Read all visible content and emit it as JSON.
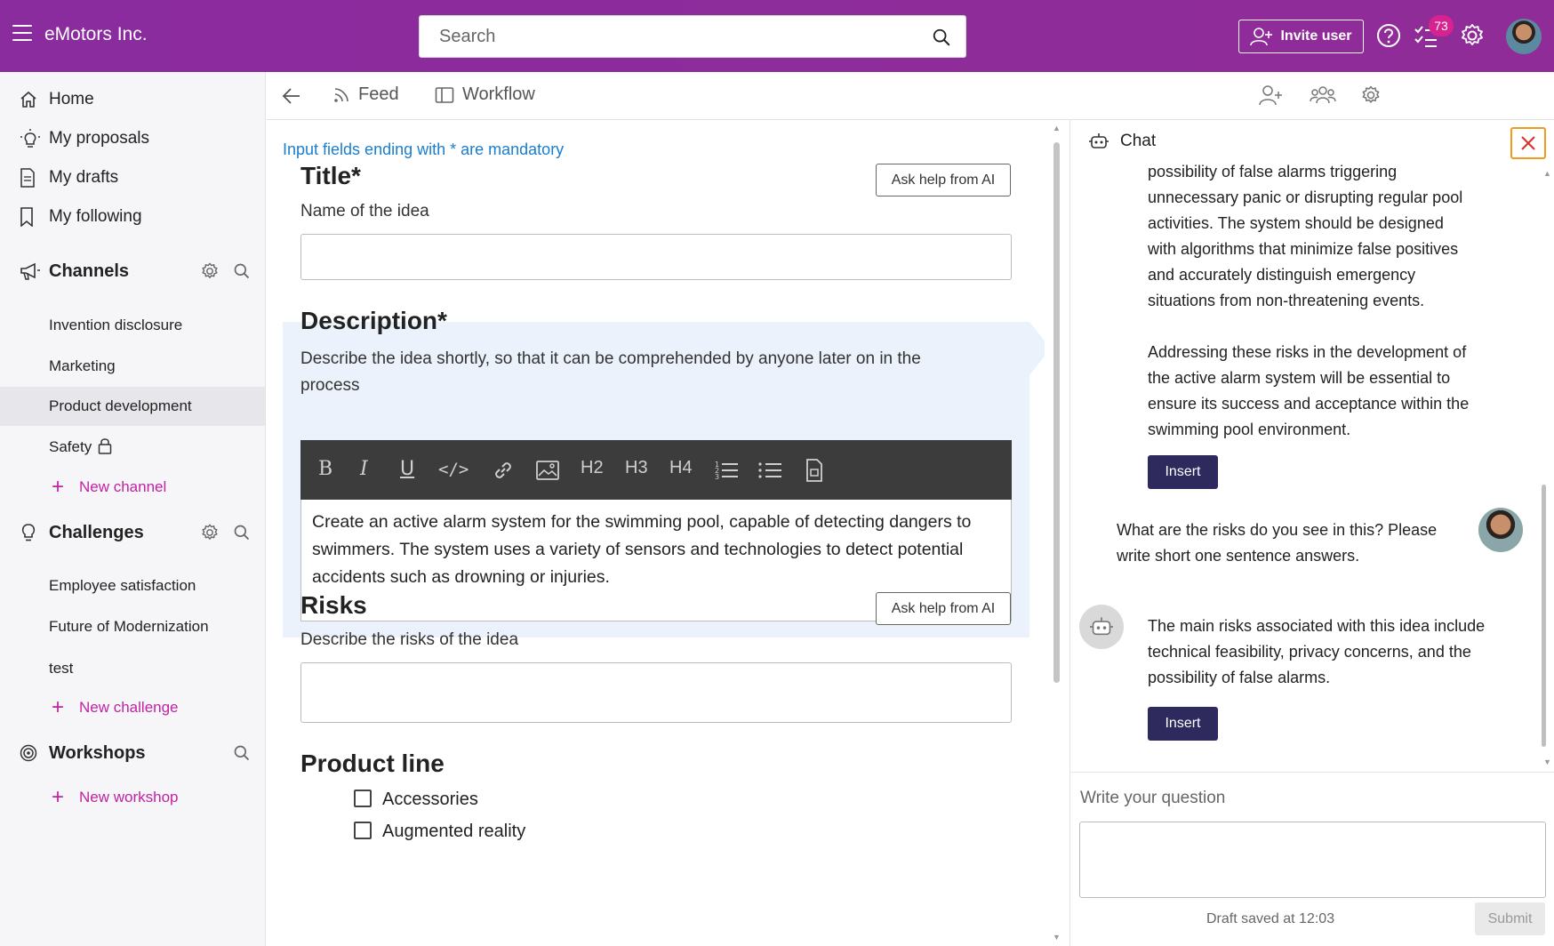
{
  "topbar": {
    "brand": "eMotors Inc.",
    "search_placeholder": "Search",
    "invite_label": "Invite user",
    "tasks_badge": "73",
    "bg_color": "#8b2a9c"
  },
  "sidebar": {
    "nav": [
      {
        "label": "Home",
        "icon": "home-icon"
      },
      {
        "label": "My proposals",
        "icon": "lightbulb-icon"
      },
      {
        "label": "My drafts",
        "icon": "document-icon"
      },
      {
        "label": "My following",
        "icon": "bookmark-icon"
      }
    ],
    "channels": {
      "title": "Channels",
      "items": [
        "Invention disclosure",
        "Marketing",
        "Product development",
        "Safety"
      ],
      "active": "Product development",
      "locked": "Safety",
      "add_label": "New channel"
    },
    "challenges": {
      "title": "Challenges",
      "items": [
        "Employee satisfaction",
        "Future of Modernization",
        "test"
      ],
      "add_label": "New challenge"
    },
    "workshops": {
      "title": "Workshops",
      "add_label": "New workshop"
    },
    "accent_color": "#c023a4"
  },
  "main_header": {
    "tabs": [
      "Feed",
      "Workflow"
    ]
  },
  "form": {
    "mandatory_note": "Input fields ending with * are mandatory",
    "title_field": {
      "label": "Title*",
      "hint": "Name of the idea",
      "ask_ai": "Ask help from AI",
      "value": ""
    },
    "description_field": {
      "label": "Description*",
      "hint": "Describe the idea shortly, so that it can be comprehended by anyone later on in the process",
      "toolbar": [
        "B",
        "I",
        "U",
        "</>",
        "link",
        "image",
        "H2",
        "H3",
        "H4",
        "ordered-list",
        "bullet-list",
        "attachment"
      ],
      "value": "Create an active alarm system for the swimming pool, capable of detecting dangers to swimmers. The system uses a variety of sensors and technologies to detect potential accidents such as drowning or injuries."
    },
    "risks_field": {
      "label": "Risks",
      "hint": "Describe the risks of the idea",
      "ask_ai": "Ask help from AI",
      "value": ""
    },
    "product_line": {
      "label": "Product line",
      "options": [
        "Accessories",
        "Augmented reality"
      ]
    },
    "highlight_color": "#ebf2fc"
  },
  "chat": {
    "title": "Chat",
    "messages": [
      {
        "from": "bot",
        "text_1": "possibility of false alarms triggering unnecessary panic or disrupting regular pool activities. The system should be designed with algorithms that minimize false positives and accurately distinguish emergency situations from non-threatening events.",
        "text_2": "Addressing these risks in the development of the active alarm system will be essential to ensure its success and acceptance within the swimming pool environment.",
        "insert": "Insert"
      },
      {
        "from": "user",
        "text": "What are the risks do you see in this? Please write short one sentence answers."
      },
      {
        "from": "bot",
        "text": "The main risks associated with this idea include technical feasibility, privacy concerns, and the possibility of false alarms.",
        "insert": "Insert"
      }
    ],
    "question_label": "Write your question",
    "draft_status": "Draft saved at 12:03",
    "submit_label": "Submit",
    "button_color": "#2e2a5e",
    "close_border_color": "#f29a1f"
  }
}
